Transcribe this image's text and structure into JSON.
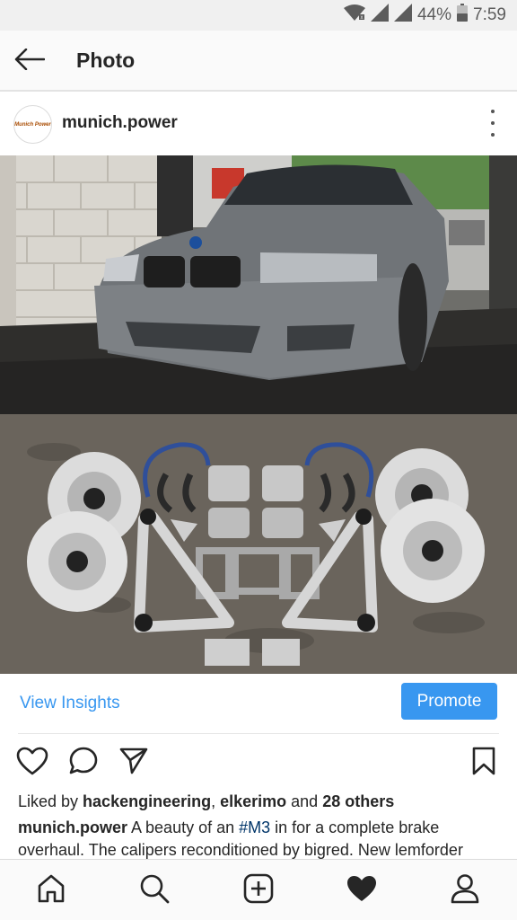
{
  "status_bar": {
    "battery_percent": "44%",
    "time": "7:59",
    "icons": [
      "wifi-icon",
      "signal-icon",
      "signal-icon",
      "battery-icon"
    ]
  },
  "app_bar": {
    "title": "Photo",
    "back_icon": "arrow-left-icon"
  },
  "post": {
    "username": "munich.power",
    "avatar_text": "Munich Power",
    "more_icon": "more-vertical-icon",
    "photo_icon": "car-and-brake-parts-photo"
  },
  "insights": {
    "view_label": "View Insights",
    "promote_label": "Promote",
    "accent_color": "#3897f0"
  },
  "actions": {
    "icons": [
      "heart-outline-icon",
      "comment-icon",
      "share-icon",
      "bookmark-icon"
    ]
  },
  "likes": {
    "prefix": "Liked by ",
    "user1": "hackengineering",
    "sep": ", ",
    "user2": "elkerimo",
    "and": " and ",
    "others": "28 others"
  },
  "caption": {
    "username": "munich.power",
    "text1": " A beauty of an ",
    "hashtag": "#M3",
    "text2": " in for a complete brake overhaul. The calipers reconditioned by bigred. New lemforder"
  },
  "bottom_nav": {
    "icons": [
      "home-icon",
      "search-icon",
      "add-post-icon",
      "heart-filled-icon",
      "profile-icon"
    ]
  }
}
